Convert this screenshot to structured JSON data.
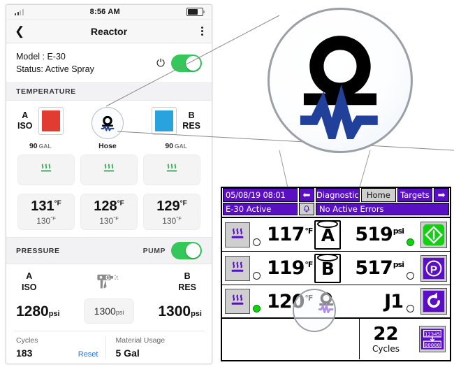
{
  "phone": {
    "statusbar": {
      "time": "8:56 AM",
      "signal_icon": "signal-bars-icon",
      "battery_icon": "battery-icon"
    },
    "navbar": {
      "back_icon": "chevron-left-icon",
      "title": "Reactor",
      "menu_icon": "kebab-menu-icon"
    },
    "device": {
      "model_line": "Model : E-30",
      "status_line": "Status: Active Spray",
      "power_icon": "power-icon",
      "power_toggle_state": "on",
      "toggle_color": "#34c759"
    },
    "temperature": {
      "header": "TEMPERATURE",
      "tanks": [
        {
          "label_top": "A",
          "label_bottom": "ISO",
          "volume": "90",
          "unit": "GAL",
          "fill_color": "#e23b30"
        },
        {
          "label_top": "B",
          "label_bottom": "RES",
          "volume": "90",
          "unit": "GAL",
          "fill_color": "#29a3e0"
        }
      ],
      "hose": {
        "icon": "hose-heater-icon",
        "label": "Hose"
      },
      "heat_tiles": [
        {
          "icon": "heat-waves-icon",
          "color": "#3aa657"
        },
        {
          "icon": "heat-waves-icon",
          "color": "#3aa657"
        },
        {
          "icon": "heat-waves-icon",
          "color": "#3aa657"
        }
      ],
      "readouts": [
        {
          "actual": "131",
          "actual_unit": "°F",
          "target": "130",
          "target_unit": "°F"
        },
        {
          "actual": "128",
          "actual_unit": "°F",
          "target": "130",
          "target_unit": "°F"
        },
        {
          "actual": "129",
          "actual_unit": "°F",
          "target": "130",
          "target_unit": "°F"
        }
      ]
    },
    "pressure": {
      "header": "PRESSURE",
      "pump_label": "PUMP",
      "pump_toggle_state": "on",
      "labels": [
        {
          "top": "A",
          "bottom": "ISO"
        },
        {
          "top": "B",
          "bottom": "RES"
        }
      ],
      "gun_icon": "spray-gun-icon",
      "gun_icon_letter": "G",
      "a_value": "1280",
      "a_unit": "psi",
      "center_value": "1300",
      "center_unit": "psi",
      "b_value": "1300",
      "b_unit": "psi"
    },
    "footer": {
      "cycles_label": "Cycles",
      "cycles_value": "183",
      "reset_label": "Reset",
      "material_label": "Material Usage",
      "material_value": "5 Gal"
    }
  },
  "magnifier": {
    "icon_name": "hose-heater-icon-magnified",
    "hose_color": "#000000",
    "heater_color": "#20409a"
  },
  "hmi": {
    "topbar": {
      "datetime": "05/08/19 08:01",
      "prev_icon": "arrow-left-icon",
      "next_icon": "arrow-right-icon",
      "tabs": [
        {
          "label": "Diagnostic",
          "active": false
        },
        {
          "label": "Home",
          "active": true
        },
        {
          "label": "Targets",
          "active": false
        }
      ]
    },
    "statusbar": {
      "device_status": "E-30 Active",
      "bell_icon": "bell-icon",
      "errors": "No Active Errors"
    },
    "accent_purple": "#5b0fc4",
    "accent_green": "#13d013",
    "rows": [
      {
        "heat_icon": "heat-waves-icon",
        "heat_led": "off",
        "temp": "117",
        "temp_unit": "°F",
        "vessel_label": "A",
        "vessel_icon": "drum-icon",
        "pressure": "519",
        "pressure_unit": "psi",
        "status_led": "on",
        "action_icon": "spray-start-icon",
        "action_color": "#13d013"
      },
      {
        "heat_icon": "heat-waves-icon",
        "heat_led": "off",
        "temp": "119",
        "temp_unit": "°F",
        "vessel_label": "B",
        "vessel_icon": "drum-icon",
        "pressure": "517",
        "pressure_unit": "psi",
        "status_led": "off",
        "action_icon": "park-icon",
        "action_color": "#5b0fc4"
      },
      {
        "heat_icon": "heat-waves-icon",
        "heat_led": "on",
        "temp": "120",
        "temp_unit": "°F",
        "vessel_label": "",
        "vessel_icon": "hose-heater-icon",
        "pressure": "J1",
        "pressure_unit": "",
        "status_led": "off",
        "action_icon": "reset-rotate-icon",
        "action_color": "#5b0fc4"
      }
    ],
    "bottom": {
      "cycles_value": "22",
      "cycles_label": "Cycles",
      "counter_reset_icon": "counter-reset-icon",
      "counter_from": "12345",
      "counter_to": "00000"
    }
  }
}
